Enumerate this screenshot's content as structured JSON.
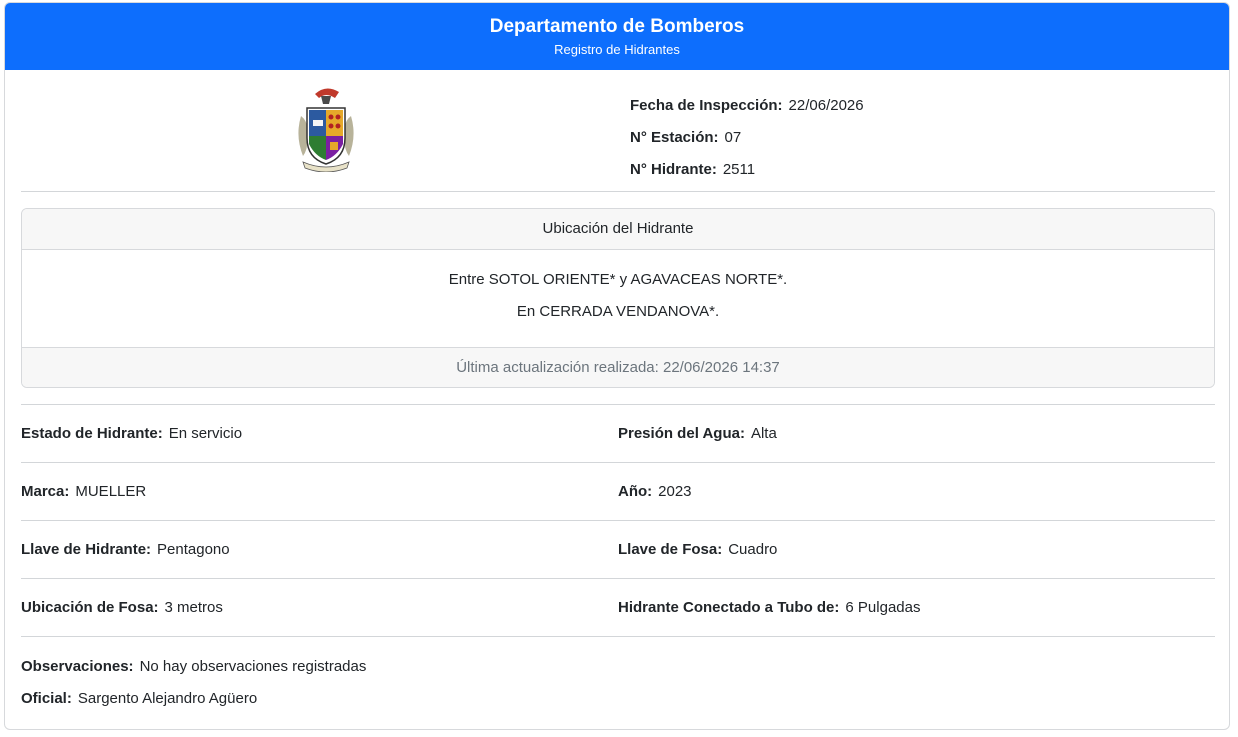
{
  "header": {
    "title": "Departamento de Bomberos",
    "subtitle": "Registro de Hidrantes"
  },
  "logo": {
    "icon": "coat-of-arms-icon"
  },
  "inspection": {
    "fecha_label": "Fecha de Inspección:",
    "fecha_value": "22/06/2026",
    "estacion_label": "N° Estación:",
    "estacion_value": "07",
    "hidrante_label": "N° Hidrante:",
    "hidrante_value": "2511"
  },
  "location": {
    "title": "Ubicación del Hidrante",
    "line1": "Entre SOTOL ORIENTE* y AGAVACEAS NORTE*.",
    "line2": "En CERRADA VENDANOVA*.",
    "footer": "Última actualización realizada: 22/06/2026 14:37"
  },
  "details": [
    {
      "left_label": "Estado de Hidrante:",
      "left_value": "En servicio",
      "right_label": "Presión del Agua:",
      "right_value": "Alta"
    },
    {
      "left_label": "Marca:",
      "left_value": "MUELLER",
      "right_label": "Año:",
      "right_value": "2023"
    },
    {
      "left_label": "Llave de Hidrante:",
      "left_value": "Pentagono",
      "right_label": "Llave de Fosa:",
      "right_value": "Cuadro"
    },
    {
      "left_label": "Ubicación de Fosa:",
      "left_value": "3 metros",
      "right_label": "Hidrante Conectado a Tubo de:",
      "right_value": "6 Pulgadas"
    }
  ],
  "observaciones": {
    "label": "Observaciones:",
    "value": "No hay observaciones registradas"
  },
  "oficial": {
    "label": "Oficial:",
    "value": "Sargento Alejandro Agüero"
  }
}
